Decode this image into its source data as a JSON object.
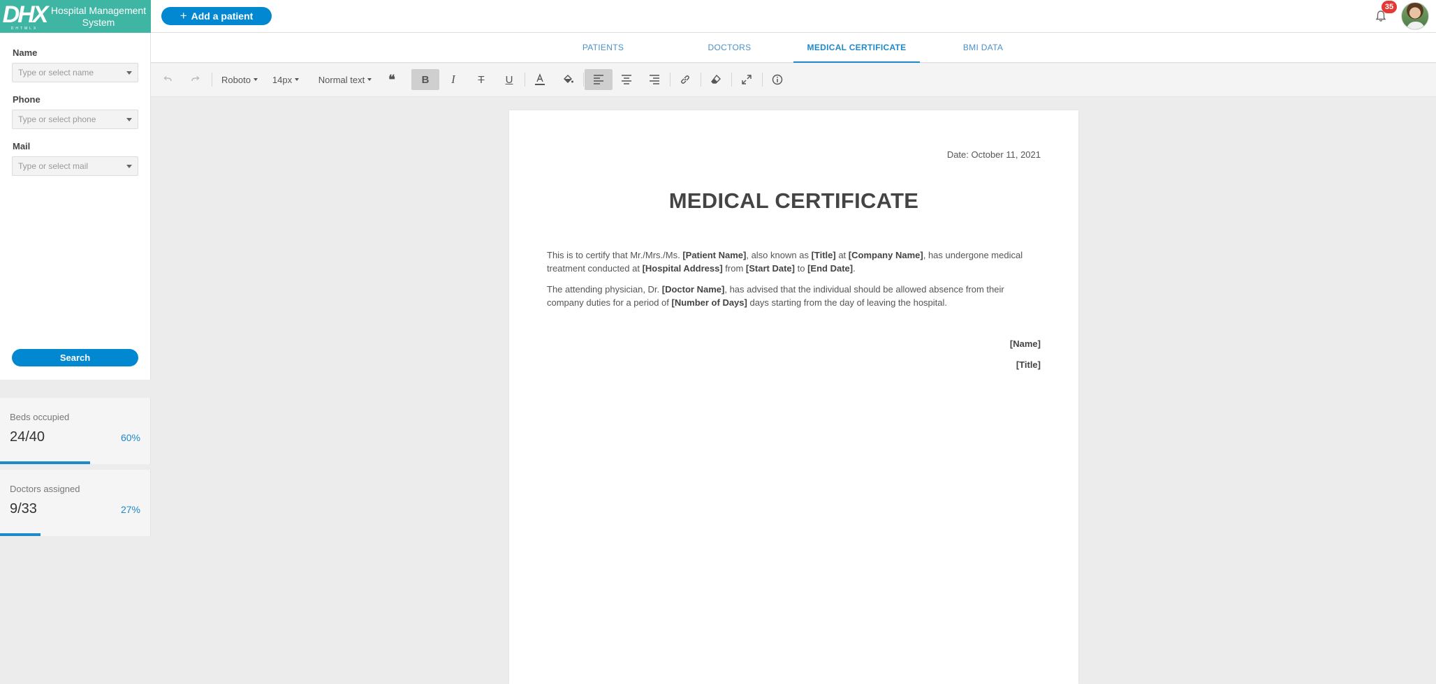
{
  "header": {
    "logo_text": "DHX",
    "logo_sub": "DHTMLX",
    "app_name": "Hospital Management System",
    "add_button_label": "Add a patient",
    "notification_count": "35"
  },
  "filters": {
    "name": {
      "label": "Name",
      "placeholder": "Type or select name"
    },
    "phone": {
      "label": "Phone",
      "placeholder": "Type or select phone"
    },
    "mail": {
      "label": "Mail",
      "placeholder": "Type or select mail"
    },
    "search_label": "Search"
  },
  "stats": [
    {
      "title": "Beds occupied",
      "value": "24/40",
      "percent_label": "60%",
      "progress": 0.6
    },
    {
      "title": "Doctors assigned",
      "value": "9/33",
      "percent_label": "27%",
      "progress": 0.27
    }
  ],
  "tabs": [
    {
      "label": "PATIENTS",
      "active": false
    },
    {
      "label": "DOCTORS",
      "active": false
    },
    {
      "label": "MEDICAL CERTIFICATE",
      "active": true
    },
    {
      "label": "BMI DATA",
      "active": false
    }
  ],
  "toolbar": {
    "font_family": "Roboto",
    "font_size": "14px",
    "block_style": "Normal text",
    "icons": [
      "undo-icon",
      "redo-icon",
      "quote-icon",
      "bold-icon",
      "italic-icon",
      "strikethrough-icon",
      "underline-icon",
      "text-color-icon",
      "fill-color-icon",
      "align-left-icon",
      "align-center-icon",
      "align-right-icon",
      "link-icon",
      "eraser-icon",
      "fullscreen-icon",
      "info-icon"
    ]
  },
  "document": {
    "date": "Date: October 11, 2021",
    "title": "MEDICAL CERTIFICATE",
    "p1": {
      "t1": "This is to certify that Mr./Mrs./Ms. ",
      "b1": "[Patient Name]",
      "t2": ", also known as ",
      "b2": "[Title]",
      "t3": " at ",
      "b3": "[Company Name]",
      "t4": ", has undergone medical treatment conducted at ",
      "b4": "[Hospital Address]",
      "t5": " from ",
      "b5": "[Start Date]",
      "t6": " to ",
      "b6": "[End Date]",
      "t7": "."
    },
    "p2": {
      "t1": "The attending physician, Dr. ",
      "b1": "[Doctor Name]",
      "t2": ", has advised that the individual should be allowed absence from their company duties for a period of ",
      "b2": "[Number of Days]",
      "t3": " days starting from the day of leaving the hospital."
    },
    "sign_name": "[Name]",
    "sign_title": "[Title]"
  }
}
